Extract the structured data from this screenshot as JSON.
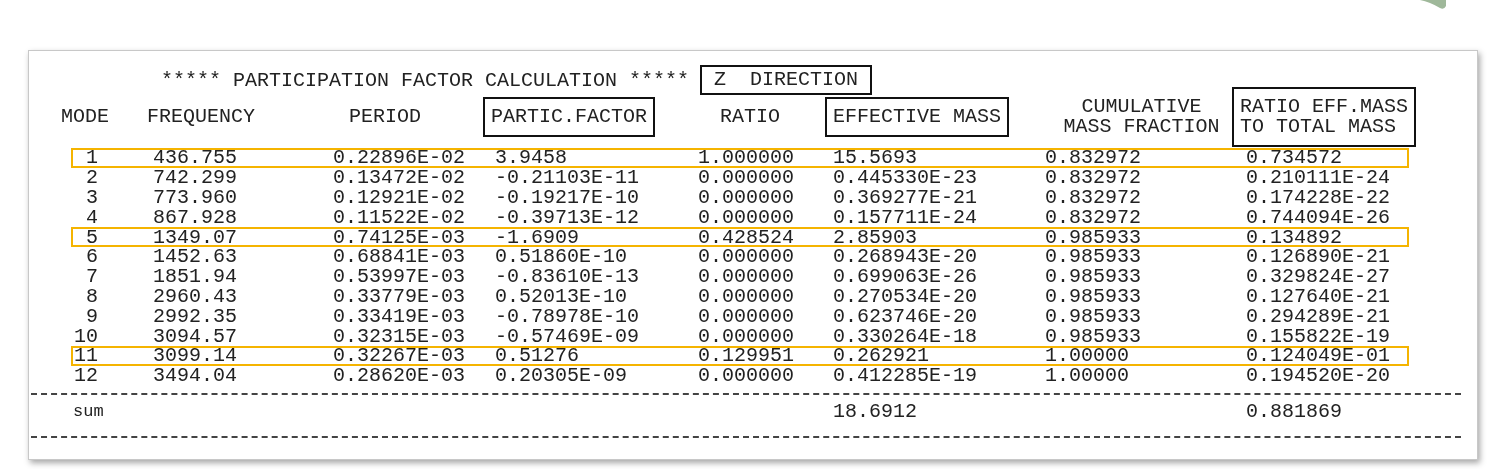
{
  "title": {
    "text": "***** PARTICIPATION FACTOR CALCULATION *****",
    "direction": "Z  DIRECTION",
    "direction_boxed": true
  },
  "columns": [
    {
      "lines": [
        "MODE"
      ],
      "boxed": false
    },
    {
      "lines": [
        "FREQUENCY"
      ],
      "boxed": false
    },
    {
      "lines": [
        "PERIOD"
      ],
      "boxed": false
    },
    {
      "lines": [
        "PARTIC.FACTOR"
      ],
      "boxed": true
    },
    {
      "lines": [
        "RATIO"
      ],
      "boxed": false
    },
    {
      "lines": [
        "EFFECTIVE MASS"
      ],
      "boxed": true
    },
    {
      "lines": [
        "CUMULATIVE",
        "MASS FRACTION"
      ],
      "boxed": false
    },
    {
      "lines": [
        "RATIO EFF.MASS",
        "TO TOTAL MASS"
      ],
      "boxed": true
    }
  ],
  "rows": [
    {
      "highlighted": true,
      "cells": [
        "1",
        "436.755",
        "0.22896E-02",
        "3.9458",
        "1.000000",
        "15.5693",
        "0.832972",
        "0.734572"
      ]
    },
    {
      "highlighted": false,
      "cells": [
        "2",
        "742.299",
        "0.13472E-02",
        "-0.21103E-11",
        "0.000000",
        "0.445330E-23",
        "0.832972",
        "0.210111E-24"
      ]
    },
    {
      "highlighted": false,
      "cells": [
        "3",
        "773.960",
        "0.12921E-02",
        "-0.19217E-10",
        "0.000000",
        "0.369277E-21",
        "0.832972",
        "0.174228E-22"
      ]
    },
    {
      "highlighted": false,
      "cells": [
        "4",
        "867.928",
        "0.11522E-02",
        "-0.39713E-12",
        "0.000000",
        "0.157711E-24",
        "0.832972",
        "0.744094E-26"
      ]
    },
    {
      "highlighted": true,
      "cells": [
        "5",
        "1349.07",
        "0.74125E-03",
        "-1.6909",
        "0.428524",
        "2.85903",
        "0.985933",
        "0.134892"
      ]
    },
    {
      "highlighted": false,
      "cells": [
        "6",
        "1452.63",
        "0.68841E-03",
        "0.51860E-10",
        "0.000000",
        "0.268943E-20",
        "0.985933",
        "0.126890E-21"
      ]
    },
    {
      "highlighted": false,
      "cells": [
        "7",
        "1851.94",
        "0.53997E-03",
        "-0.83610E-13",
        "0.000000",
        "0.699063E-26",
        "0.985933",
        "0.329824E-27"
      ]
    },
    {
      "highlighted": false,
      "cells": [
        "8",
        "2960.43",
        "0.33779E-03",
        "0.52013E-10",
        "0.000000",
        "0.270534E-20",
        "0.985933",
        "0.127640E-21"
      ]
    },
    {
      "highlighted": false,
      "cells": [
        "9",
        "2992.35",
        "0.33419E-03",
        "-0.78978E-10",
        "0.000000",
        "0.623746E-20",
        "0.985933",
        "0.294289E-21"
      ]
    },
    {
      "highlighted": false,
      "cells": [
        "10",
        "3094.57",
        "0.32315E-03",
        "-0.57469E-09",
        "0.000000",
        "0.330264E-18",
        "0.985933",
        "0.155822E-19"
      ]
    },
    {
      "highlighted": true,
      "cells": [
        "11",
        "3099.14",
        "0.32267E-03",
        "0.51276",
        "0.129951",
        "0.262921",
        "1.00000",
        "0.124049E-01"
      ]
    },
    {
      "highlighted": false,
      "cells": [
        "12",
        "3494.04",
        "0.28620E-03",
        "0.20305E-09",
        "0.000000",
        "0.412285E-19",
        "1.00000",
        "0.194520E-20"
      ]
    }
  ],
  "sum": {
    "label": "sum",
    "effective_mass": "18.6912",
    "ratio_eff_mass": "0.881869"
  }
}
